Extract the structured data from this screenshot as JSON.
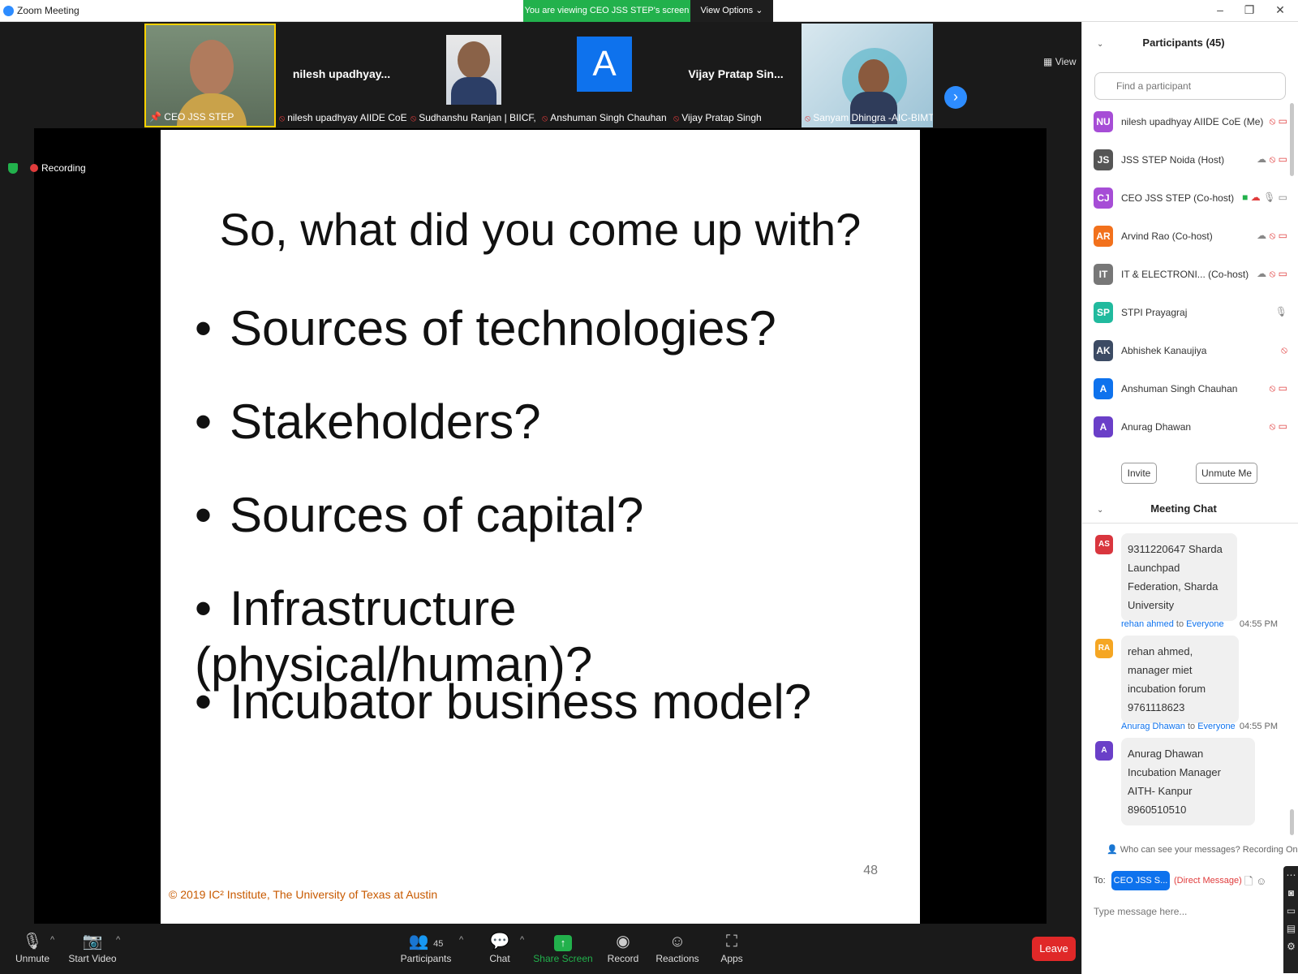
{
  "window": {
    "title": "Zoom Meeting",
    "share_banner": "You are viewing CEO JSS STEP's screen",
    "view_options": "View Options ⌄",
    "minimize": "–",
    "maximize": "❐",
    "close": "✕"
  },
  "video": {
    "view_label": "View",
    "recording_label": "Recording",
    "tiles": [
      {
        "name": "CEO JSS STEP",
        "center_name": ""
      },
      {
        "name": "nilesh upadhyay AIIDE CoE",
        "center_name": "nilesh  upadhyay..."
      },
      {
        "name": "Sudhanshu Ranjan | BIICF, J...",
        "center_name": ""
      },
      {
        "name": "Anshuman Singh Chauhan",
        "center_name": "",
        "avatar": "A"
      },
      {
        "name": "Vijay Pratap Singh",
        "center_name": "Vijay  Pratap  Sin..."
      },
      {
        "name": "Sanyam Dhingra -AIC-BIMT...",
        "center_name": ""
      }
    ]
  },
  "slide": {
    "title": "So, what did you come up with?",
    "bullets": [
      "Sources of technologies?",
      "Stakeholders?",
      "Sources of capital?",
      "Infrastructure (physical/human)?",
      "Incubator business model?"
    ],
    "page_number": "48",
    "copyright": "© 2019 IC² Institute, The University of Texas at Austin"
  },
  "toolbar": {
    "unmute": "Unmute",
    "start_video": "Start Video",
    "participants": "Participants",
    "participants_count": "45",
    "chat": "Chat",
    "share_screen": "Share Screen",
    "record": "Record",
    "reactions": "Reactions",
    "apps": "Apps",
    "leave": "Leave"
  },
  "participants": {
    "header": "Participants (45)",
    "search_placeholder": "Find a participant",
    "invite": "Invite",
    "unmute_me": "Unmute Me",
    "list": [
      {
        "initials": "NU",
        "name": "nilesh upadhyay AIIDE CoE (Me)",
        "color": "#a64dd6"
      },
      {
        "initials": "JS",
        "name": "JSS STEP Noida (Host)",
        "color": "#555555"
      },
      {
        "initials": "CJ",
        "name": "CEO JSS STEP (Co-host)",
        "color": "#a64dd6"
      },
      {
        "initials": "AR",
        "name": "Arvind Rao (Co-host)",
        "color": "#f2711c"
      },
      {
        "initials": "IT",
        "name": "IT & ELECTRONI...  (Co-host)",
        "color": "#777777"
      },
      {
        "initials": "SP",
        "name": "STPI Prayagraj",
        "color": "#21ba9e"
      },
      {
        "initials": "AK",
        "name": "Abhishek Kanaujiya",
        "color": "#3c4b64"
      },
      {
        "initials": "A",
        "name": "Anshuman Singh Chauhan",
        "color": "#0e72ed"
      },
      {
        "initials": "A",
        "name": "Anurag Dhawan",
        "color": "#6a3fc8"
      }
    ]
  },
  "chat": {
    "header": "Meeting Chat",
    "messages": [
      {
        "initials": "AS",
        "color": "#d9363e",
        "sender": "",
        "to": "",
        "recipient": "",
        "time": "",
        "text": "9311220647 Sharda Launchpad Federation, Sharda University"
      },
      {
        "initials": "RA",
        "color": "#f5a623",
        "sender": "rehan ahmed",
        "to": "to",
        "recipient": "Everyone",
        "time": "04:55 PM",
        "text": "rehan ahmed, manager miet incubation forum 9761118623"
      },
      {
        "initials": "A",
        "color": "#6a3fc8",
        "sender": "Anurag Dhawan",
        "to": "to",
        "recipient": "Everyone",
        "time": "04:55 PM",
        "text": "Anurag Dhawan Incubation Manager AITH- Kanpur 8960510510"
      }
    ],
    "who_can_see": "Who can see your messages? Recording On",
    "to_label": "To:",
    "to_value": "CEO JSS S... ⌄",
    "direct_message": "(Direct Message)",
    "input_placeholder": "Type message here..."
  }
}
